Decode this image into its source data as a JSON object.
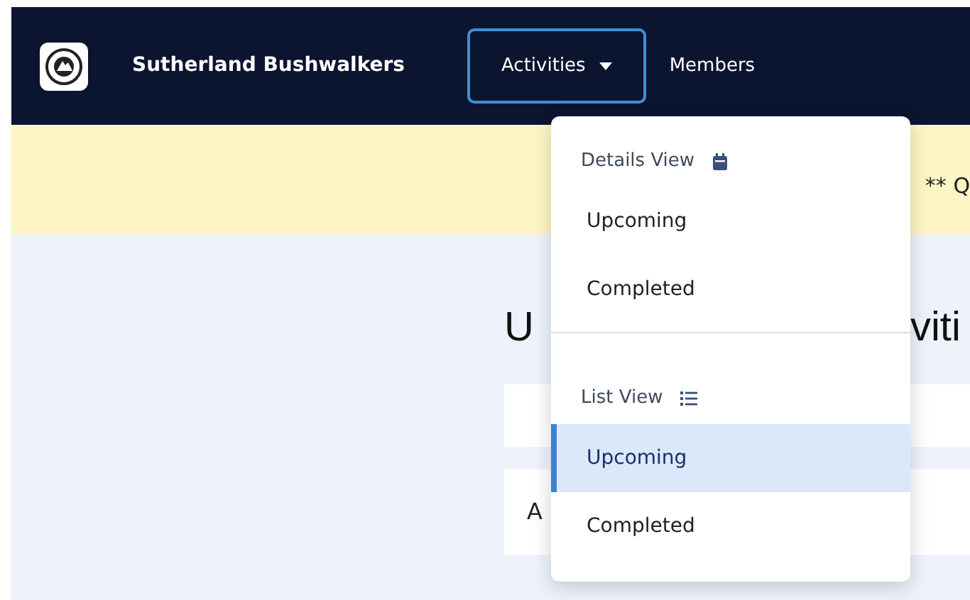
{
  "navbar": {
    "brand": "Sutherland Bushwalkers",
    "items": [
      {
        "label": "Activities",
        "kind": "dropdown",
        "expanded": true
      },
      {
        "label": "Members",
        "kind": "link",
        "expanded": false
      }
    ]
  },
  "banner": {
    "text": "** Q"
  },
  "page": {
    "heading_parts": [
      "U",
      "viti"
    ],
    "cards": [
      {
        "text": "A"
      }
    ]
  },
  "dropdown": {
    "sections": [
      {
        "header": "Details View",
        "items": [
          {
            "label": "Upcoming",
            "selected": false
          },
          {
            "label": "Completed",
            "selected": false
          }
        ]
      },
      {
        "header": "List View",
        "items": [
          {
            "label": "Upcoming",
            "selected": true
          },
          {
            "label": "Completed",
            "selected": false
          }
        ]
      }
    ]
  }
}
